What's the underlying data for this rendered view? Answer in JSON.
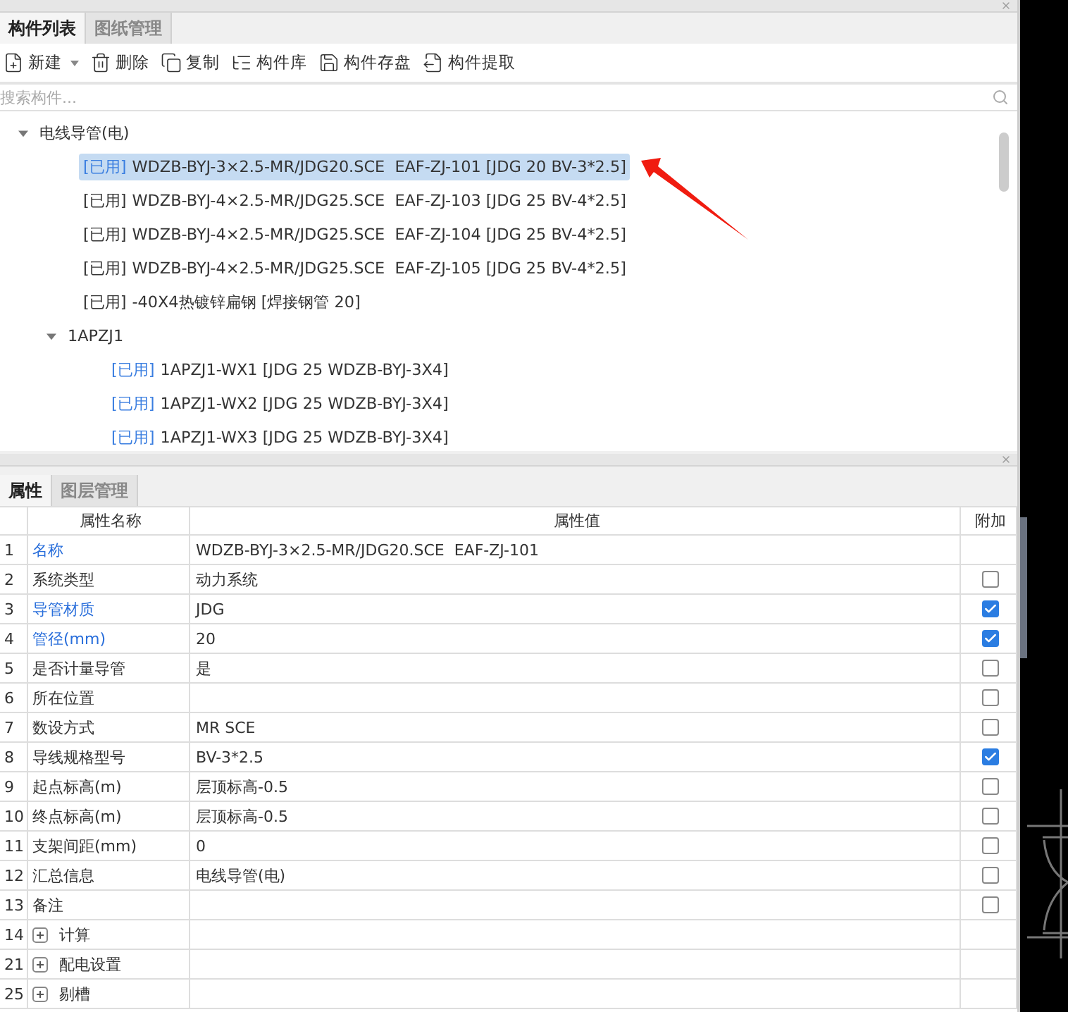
{
  "top_panel": {
    "tabs": [
      {
        "label": "构件列表",
        "selected": true
      },
      {
        "label": "图纸管理",
        "selected": false
      }
    ],
    "toolbar": [
      {
        "label": "新建",
        "kind": "new",
        "dropdown": true
      },
      {
        "label": "删除",
        "kind": "delete",
        "dropdown": false
      },
      {
        "label": "复制",
        "kind": "copy",
        "dropdown": false
      },
      {
        "label": "构件库",
        "kind": "library",
        "dropdown": false
      },
      {
        "label": "构件存盘",
        "kind": "save",
        "dropdown": false
      },
      {
        "label": "构件提取",
        "kind": "extract",
        "dropdown": false
      }
    ],
    "search": {
      "placeholder": "搜索构件..."
    },
    "tree": [
      {
        "label": "电线导管(电)",
        "expanded": true,
        "children": [
          {
            "tag": "[已用]",
            "label": "WDZB-BYJ-3×2.5-MR/JDG20.SCE  EAF-ZJ-101 [JDG 20 BV-3*2.5]",
            "tag_highlight": true,
            "selected": true
          },
          {
            "tag": "[已用]",
            "label": "WDZB-BYJ-4×2.5-MR/JDG25.SCE  EAF-ZJ-103 [JDG 25 BV-4*2.5]",
            "tag_highlight": false,
            "selected": false
          },
          {
            "tag": "[已用]",
            "label": "WDZB-BYJ-4×2.5-MR/JDG25.SCE  EAF-ZJ-104 [JDG 25 BV-4*2.5]",
            "tag_highlight": false,
            "selected": false
          },
          {
            "tag": "[已用]",
            "label": "WDZB-BYJ-4×2.5-MR/JDG25.SCE  EAF-ZJ-105 [JDG 25 BV-4*2.5]",
            "tag_highlight": false,
            "selected": false
          },
          {
            "tag": "[已用]",
            "label": "-40X4热镀锌扁钢 [焊接钢管 20]",
            "tag_highlight": false,
            "selected": false
          },
          {
            "label": "1APZJ1",
            "expanded": true,
            "children": [
              {
                "tag": "[已用]",
                "label": "1APZJ1-WX1 [JDG 25 WDZB-BYJ-3X4]",
                "tag_highlight": true,
                "selected": false
              },
              {
                "tag": "[已用]",
                "label": "1APZJ1-WX2 [JDG 25 WDZB-BYJ-3X4]",
                "tag_highlight": true,
                "selected": false
              },
              {
                "tag": "[已用]",
                "label": "1APZJ1-WX3 [JDG 25 WDZB-BYJ-3X4]",
                "tag_highlight": true,
                "selected": false
              }
            ]
          }
        ]
      }
    ]
  },
  "bottom_panel": {
    "tabs": [
      {
        "label": "属性",
        "selected": true
      },
      {
        "label": "图层管理",
        "selected": false
      }
    ],
    "table": {
      "columns": [
        "属性名称",
        "属性值",
        "附加"
      ],
      "rows": [
        {
          "kind": "field",
          "num": "1",
          "name": "名称",
          "value": "WDZB-BYJ-3×2.5-MR/JDG20.SCE  EAF-ZJ-101",
          "public": true
        },
        {
          "kind": "field",
          "num": "2",
          "name": "系统类型",
          "value": "动力系统",
          "public": false,
          "checked": false
        },
        {
          "kind": "field",
          "num": "3",
          "name": "导管材质",
          "value": "JDG",
          "public": true,
          "checked": true
        },
        {
          "kind": "field",
          "num": "4",
          "name": "管径(mm)",
          "value": "20",
          "public": true,
          "checked": true
        },
        {
          "kind": "field",
          "num": "5",
          "name": "是否计量导管",
          "value": "是",
          "public": false,
          "checked": false
        },
        {
          "kind": "field",
          "num": "6",
          "name": "所在位置",
          "public": false,
          "checked": false
        },
        {
          "kind": "field",
          "num": "7",
          "name": "数设方式",
          "value": "MR SCE",
          "public": false,
          "checked": false
        },
        {
          "kind": "field",
          "num": "8",
          "name": "导线规格型号",
          "value": "BV-3*2.5",
          "public": false,
          "checked": true
        },
        {
          "kind": "field",
          "num": "9",
          "name": "起点标高(m)",
          "value": "层顶标高-0.5",
          "public": false,
          "checked": false
        },
        {
          "kind": "field",
          "num": "10",
          "name": "终点标高(m)",
          "value": "层顶标高-0.5",
          "public": false,
          "checked": false
        },
        {
          "kind": "field",
          "num": "11",
          "name": "支架间距(mm)",
          "value": "0",
          "public": false,
          "checked": false
        },
        {
          "kind": "field",
          "num": "12",
          "name": "汇总信息",
          "value": "电线导管(电)",
          "public": false,
          "checked": false
        },
        {
          "kind": "field",
          "num": "13",
          "name": "备注",
          "public": false,
          "checked": false
        },
        {
          "kind": "group",
          "num": "14",
          "name": "计算",
          "expanded": false
        },
        {
          "kind": "group",
          "num": "21",
          "name": "配电设置",
          "expanded": false
        },
        {
          "kind": "group",
          "num": "25",
          "name": "剔槽",
          "expanded": false
        }
      ]
    }
  }
}
